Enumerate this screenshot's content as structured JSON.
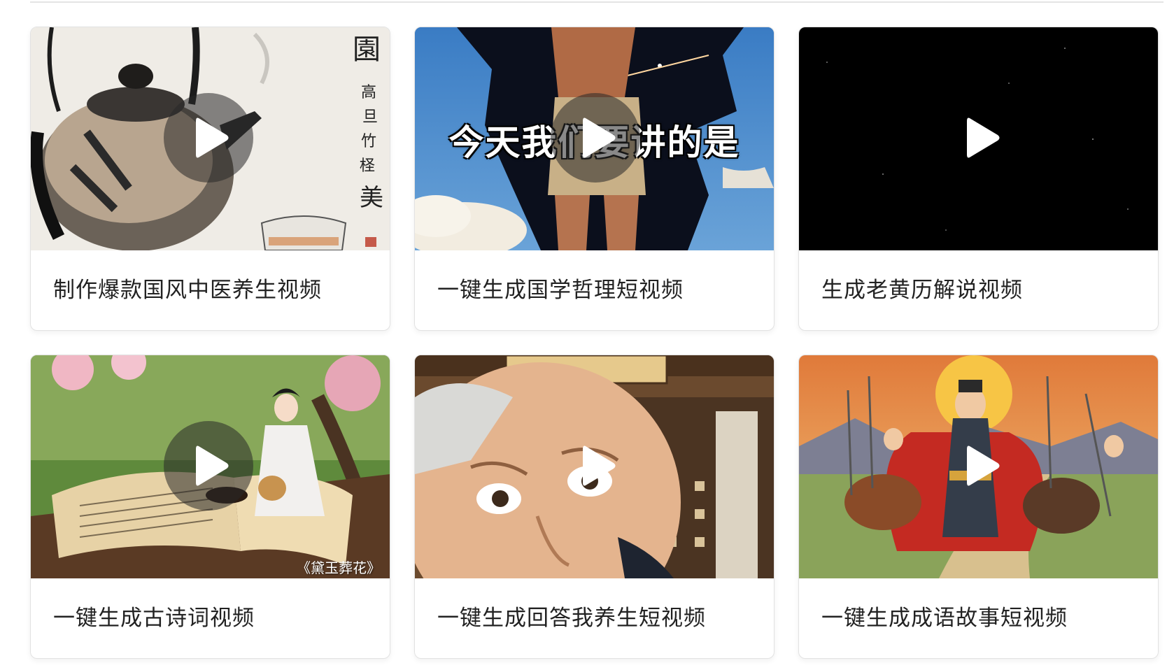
{
  "cards": [
    {
      "title": "制作爆款国风中医养生视频",
      "scene": "ink-painting-teapot",
      "play_icon": "play-icon"
    },
    {
      "title": "一键生成国学哲理短视频",
      "scene": "muscle-man-breaking-through-wall",
      "overlay_caption": "今天我们要讲的是",
      "play_icon": "play-icon"
    },
    {
      "title": "生成老黄历解说视频",
      "scene": "starry-night-sky",
      "play_icon": "play-icon"
    },
    {
      "title": "一键生成古诗词视频",
      "scene": "girl-burying-flowers-on-book",
      "watermark": "《黛玉葬花》",
      "play_icon": "play-icon"
    },
    {
      "title": "一键生成回答我养生短视频",
      "scene": "old-man-face-chinese-pharmacy",
      "play_icon": "play-icon"
    },
    {
      "title": "一键生成成语故事短视频",
      "scene": "cartoon-generals-on-horseback",
      "play_icon": "play-icon"
    }
  ],
  "colors": {
    "card_border": "#e2e2e2",
    "title_text": "#222222",
    "play_button_bg": "rgba(40,40,40,0.55)",
    "play_triangle": "#ffffff"
  }
}
